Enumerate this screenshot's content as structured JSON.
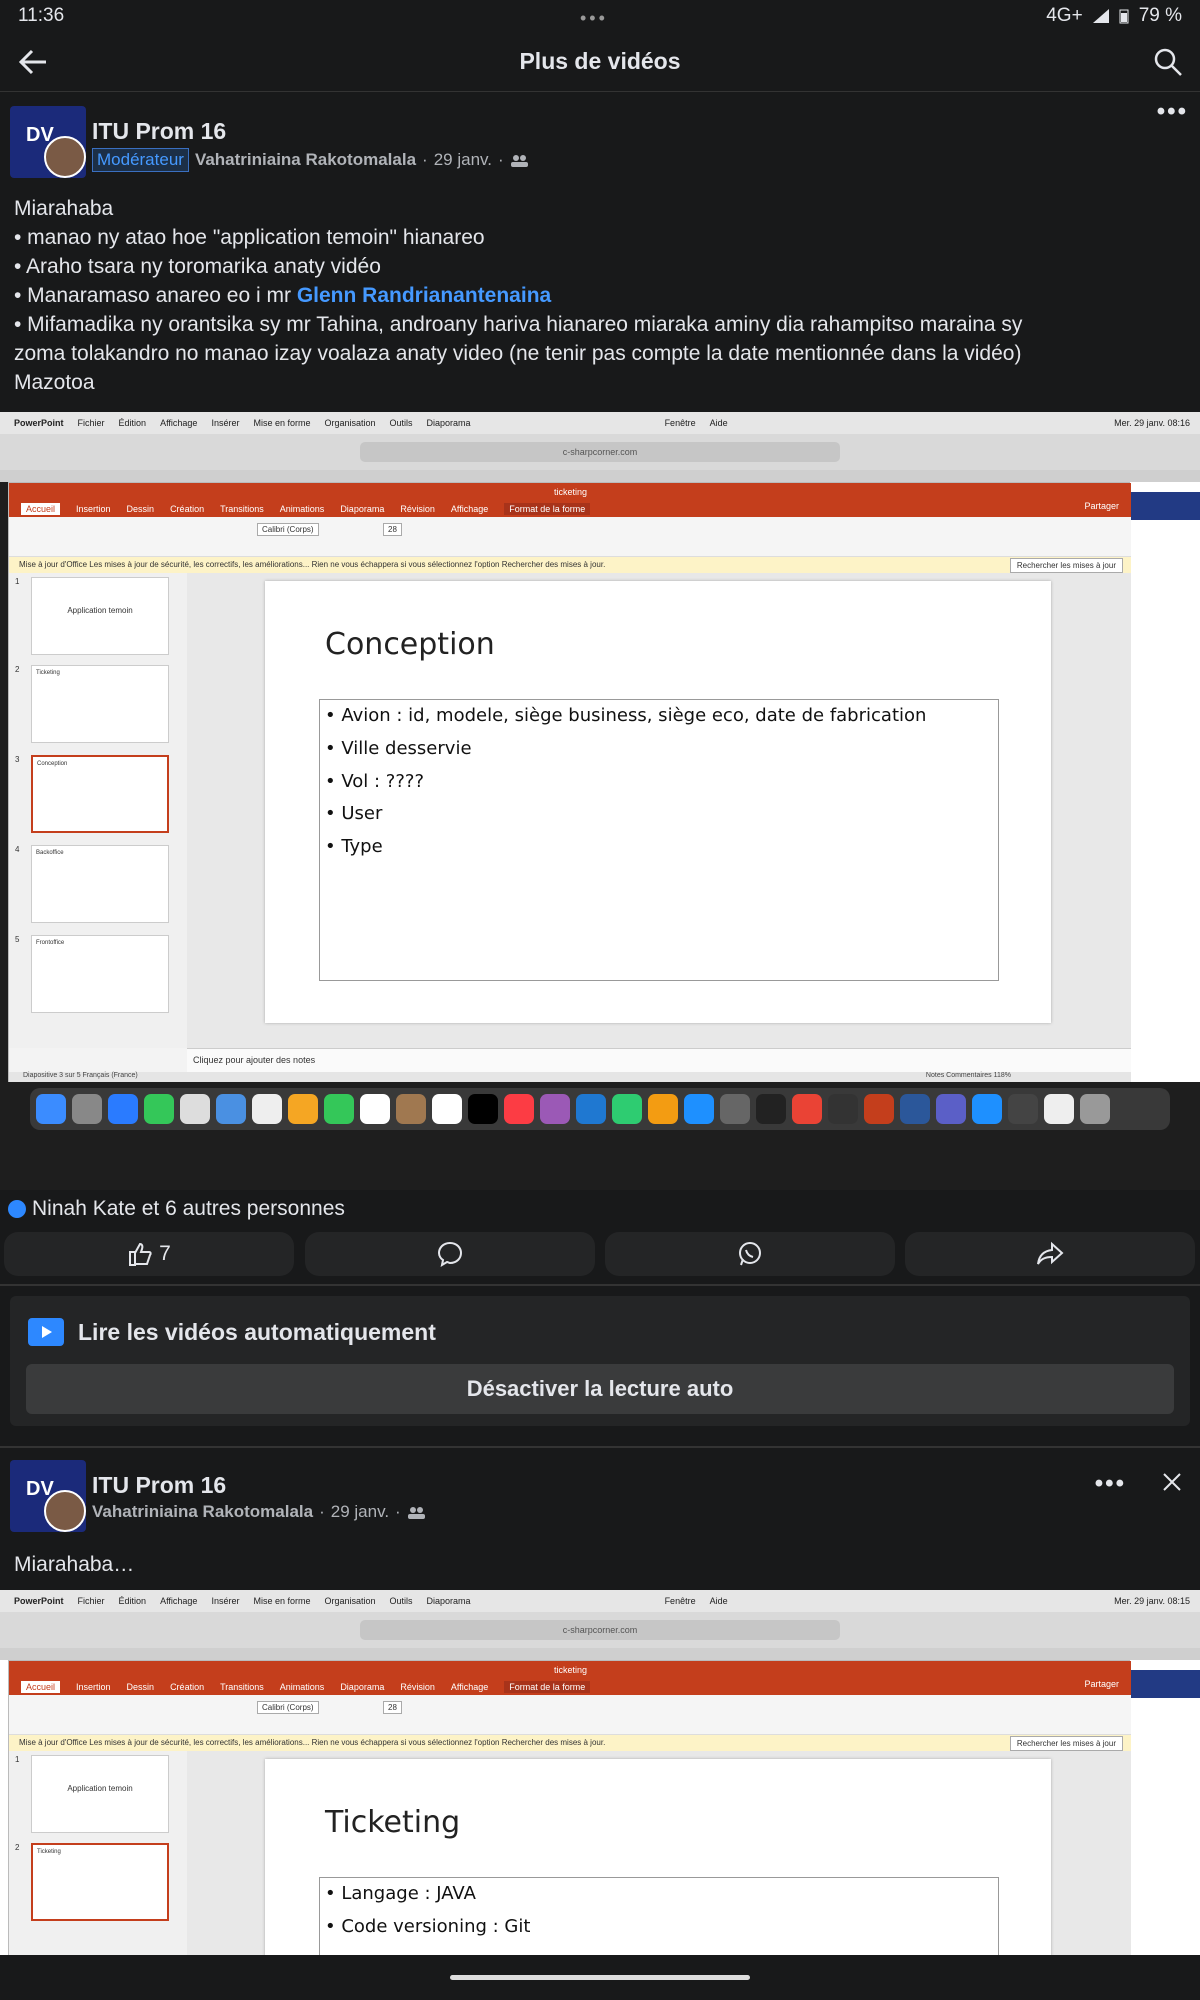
{
  "status_bar": {
    "time": "11:36",
    "network": "4G+",
    "battery": "79 %"
  },
  "header": {
    "title": "Plus de vidéos"
  },
  "post1": {
    "group": "ITU Prom 16",
    "badge": "Modérateur",
    "author": "Vahatriniaina Rakotomalala",
    "date": "29 janv.",
    "line1": "Miarahaba",
    "line2": "• manao ny atao hoe \"application temoin\" hianareo",
    "line3": "• Araho tsara ny toromarika anaty vidéo",
    "line4_prefix": "• Manaramaso anareo eo i mr ",
    "mention": "Glenn Randrianantenaina",
    "line5": "• Mifamadika ny orantsika sy mr Tahina, androany hariva hianareo miaraka aminy dia rahampitso maraina sy",
    "line6": "zoma tolakandro no manao izay voalaza anaty video (ne tenir pas compte la date mentionnée dans la vidéo)",
    "line7": "Mazotoa",
    "reactions_text": "Ninah Kate et 6 autres personnes",
    "like_count": "7"
  },
  "screenshot1": {
    "mac_menu": [
      "PowerPoint",
      "Fichier",
      "Édition",
      "Affichage",
      "Insérer",
      "Mise en forme",
      "Organisation",
      "Outils",
      "Diaporama",
      "Fenêtre",
      "Aide"
    ],
    "clock": "Mer. 29 janv. 08:16",
    "url": "c-sharpcorner.com",
    "doc_title": "ticketing",
    "ribbon_tabs": [
      "Accueil",
      "Insertion",
      "Dessin",
      "Création",
      "Transitions",
      "Animations",
      "Diaporama",
      "Révision",
      "Affichage"
    ],
    "format_tab": "Format de la forme",
    "share": "Partager",
    "font": "Calibri (Corps)",
    "size": "28",
    "info": "Mise à jour d'Office  Les mises à jour de sécurité, les correctifs, les améliorations... Rien ne vous échappera si vous sélectionnez l'option Rechercher des mises à jour.",
    "info_button": "Rechercher les mises à jour",
    "thumbs": [
      "Application temoin",
      "Ticketing",
      "Conception",
      "Backoffice",
      "Frontoffice"
    ],
    "slide_title": "Conception",
    "bullets": [
      "• Avion : id, modele, siège business, siège eco, date de fabrication",
      "• Ville desservie",
      "• Vol : ????",
      "• User",
      "• Type"
    ],
    "notes": "Cliquez pour ajouter des notes",
    "status": "Diapositive 3 sur 5    Français (France)",
    "status_right": "Notes   Commentaires   118%"
  },
  "actions": {
    "share_icon": "share-icon",
    "comment_icon": "comment-icon",
    "whatsapp_icon": "whatsapp-icon"
  },
  "autoplay": {
    "title": "Lire les vidéos automatiquement",
    "button": "Désactiver la lecture auto"
  },
  "post2": {
    "group": "ITU Prom 16",
    "author": "Vahatriniaina Rakotomalala",
    "date": "29 janv.",
    "text": "Miarahaba…"
  },
  "screenshot2": {
    "clock": "Mer. 29 janv. 08:15",
    "slide_title": "Ticketing",
    "bullets": [
      "• Langage : JAVA",
      "• Code versioning : Git"
    ]
  }
}
